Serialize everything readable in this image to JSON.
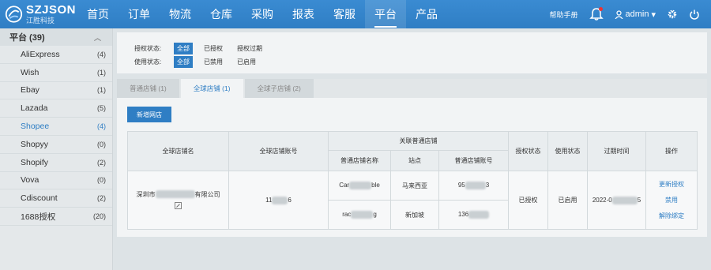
{
  "brand": {
    "title": "SZJSON",
    "subtitle": "江胜科技"
  },
  "nav": [
    "首页",
    "订单",
    "物流",
    "仓库",
    "采购",
    "报表",
    "客服",
    "平台",
    "产品"
  ],
  "header": {
    "help": "帮助手册",
    "user": "admin"
  },
  "sidebar": {
    "title": "平台 (39)",
    "items": [
      {
        "label": "AliExpress",
        "count": "(4)"
      },
      {
        "label": "Wish",
        "count": "(1)"
      },
      {
        "label": "Ebay",
        "count": "(1)"
      },
      {
        "label": "Lazada",
        "count": "(5)"
      },
      {
        "label": "Shopee",
        "count": "(4)"
      },
      {
        "label": "Shopyy",
        "count": "(0)"
      },
      {
        "label": "Shopify",
        "count": "(2)"
      },
      {
        "label": "Vova",
        "count": "(0)"
      },
      {
        "label": "Cdiscount",
        "count": "(2)"
      },
      {
        "label": "1688授权",
        "count": "(20)"
      }
    ]
  },
  "filters": {
    "auth": {
      "label": "授权状态:",
      "options": [
        "全部",
        "已授权",
        "授权过期"
      ]
    },
    "usage": {
      "label": "使用状态:",
      "options": [
        "全部",
        "已禁用",
        "已启用"
      ]
    }
  },
  "tabs": [
    "普通店铺 (1)",
    "全球店铺 (1)",
    "全球子店铺 (2)"
  ],
  "add_button": "新增网店",
  "table": {
    "headers": {
      "global_name": "全球店铺名",
      "global_account": "全球店铺账号",
      "linked": "关联普通店铺",
      "shop_name": "普通店铺名称",
      "site": "站点",
      "shop_account": "普通店铺账号",
      "auth_status": "授权状态",
      "use_status": "使用状态",
      "expire": "过期时间",
      "ops": "操作"
    },
    "row": {
      "global_name_prefix": "深圳市",
      "global_name_suffix": "有限公司",
      "global_account_prefix": "11",
      "global_account_suffix": "6",
      "subs": [
        {
          "name_prefix": "Car",
          "name_suffix": "ble",
          "site": "马来西亚",
          "acct_prefix": "95",
          "acct_suffix": "3"
        },
        {
          "name_prefix": "rac",
          "name_suffix": "g",
          "site": "新加坡",
          "acct_prefix": "136",
          "acct_suffix": ""
        }
      ],
      "auth_status": "已授权",
      "use_status": "已启用",
      "expire_prefix": "2022-0",
      "expire_suffix": "5",
      "ops": [
        "更新授权",
        "禁用",
        "解除绑定"
      ]
    }
  }
}
